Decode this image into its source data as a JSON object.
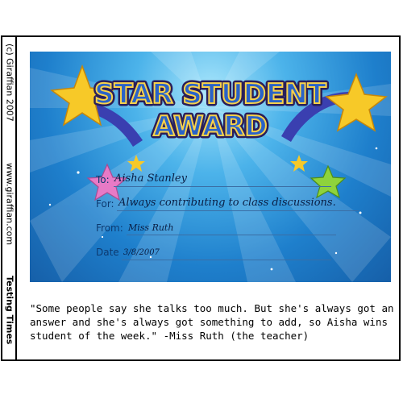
{
  "side": {
    "copyright": "(c) Giraffian 2007",
    "url": "www.giraffian.com",
    "series": "Testing Times"
  },
  "certificate": {
    "title_line1": "STAR STUDENT",
    "title_line2": "AWARD",
    "to_label": "To:",
    "to_value": "Aisha Stanley",
    "for_label": "For:",
    "for_value": "Always contributing to class discussions.",
    "from_label": "From:",
    "from_value": "Miss Ruth",
    "date_label": "Date",
    "date_value": "3/8/2007",
    "colors": {
      "background": "#1e7fcc",
      "star_gold": "#f7c928",
      "title_text": "#2a63c8"
    }
  },
  "caption": "\"Some people say she talks too much. But she's always got an answer and she's always got something to add, so Aisha wins student of the week.\" -Miss Ruth (the teacher)"
}
